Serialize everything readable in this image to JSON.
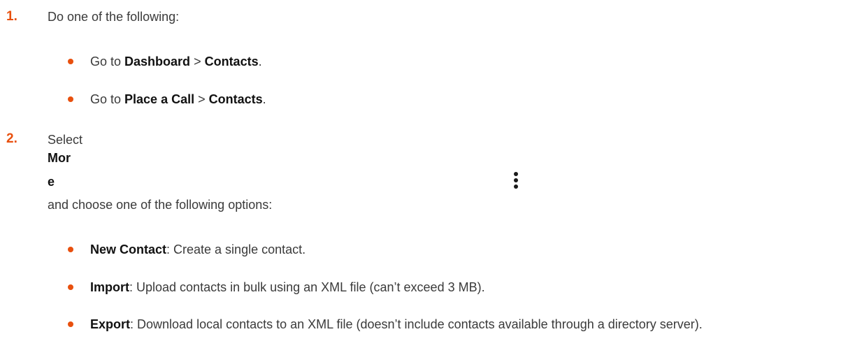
{
  "steps": [
    {
      "number": "1.",
      "text": "Do one of the following:",
      "items": [
        {
          "prefix": "Go to ",
          "bold1": "Dashboard",
          "sep": " > ",
          "bold2": "Contacts",
          "suffix": "."
        },
        {
          "prefix": "Go to ",
          "bold1": "Place a Call",
          "sep": " > ",
          "bold2": "Contacts",
          "suffix": "."
        }
      ]
    },
    {
      "number": "2.",
      "select_text": "Select",
      "more_label_line1": "Mor",
      "more_label_line2": "e",
      "icon": "more-vertical-icon",
      "choose_text": "and choose one of the following options:",
      "options": [
        {
          "label": "New Contact",
          "desc": ": Create a single contact."
        },
        {
          "label": "Import",
          "desc": ": Upload contacts in bulk using an XML file (can’t exceed 3 MB)."
        },
        {
          "label": "Export",
          "desc": ": Download local contacts to an XML file (doesn’t include contacts available through a directory server)."
        }
      ]
    }
  ],
  "colors": {
    "accent": "#e8500e",
    "text": "#3a3a3a",
    "bold_text": "#111111"
  }
}
